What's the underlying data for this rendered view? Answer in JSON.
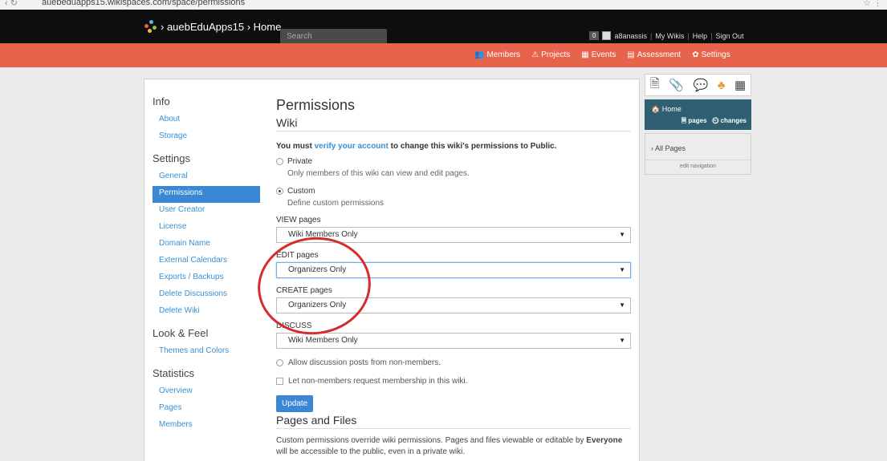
{
  "browser": {
    "url": "auebeduapps15.wikispaces.com/space/permissions",
    "nav": "‹ ↻"
  },
  "topbar": {
    "brand": "› auebEduApps15 › Home",
    "search_placeholder": "Search",
    "notification_count": "0",
    "username": "a8anassis",
    "links": [
      "My Wikis",
      "Help",
      "Sign Out"
    ]
  },
  "mainnav": {
    "items": [
      {
        "icon": "members-icon",
        "label": "Members"
      },
      {
        "icon": "projects-icon",
        "label": "Projects"
      },
      {
        "icon": "events-icon",
        "label": "Events"
      },
      {
        "icon": "assessment-icon",
        "label": "Assessment"
      },
      {
        "icon": "settings-icon",
        "label": "Settings"
      }
    ]
  },
  "sidebar": {
    "info": {
      "heading": "Info",
      "items": [
        "About",
        "Storage"
      ]
    },
    "settings": {
      "heading": "Settings",
      "items": [
        "General",
        "Permissions",
        "User Creator",
        "License",
        "Domain Name",
        "External Calendars",
        "Exports / Backups",
        "Delete Discussions",
        "Delete Wiki"
      ]
    },
    "look": {
      "heading": "Look & Feel",
      "items": [
        "Themes and Colors"
      ]
    },
    "stats": {
      "heading": "Statistics",
      "items": [
        "Overview",
        "Pages",
        "Members"
      ]
    },
    "active": "Permissions"
  },
  "main": {
    "title": "Permissions",
    "section": "Wiki",
    "verify_prefix": "You must ",
    "verify_link": "verify your account",
    "verify_suffix": " to change this wiki's permissions to Public.",
    "private_label": "Private",
    "private_desc": "Only members of this wiki can view and edit pages.",
    "custom_label": "Custom",
    "custom_desc": "Define custom permissions",
    "selected_mode": "Custom",
    "view_label": "VIEW pages",
    "view_value": "Wiki Members Only",
    "edit_label": "EDIT pages",
    "edit_value": "Organizers Only",
    "create_label": "CREATE pages",
    "create_value": "Organizers Only",
    "discuss_label": "DISCUSS",
    "discuss_value": "Wiki Members Only",
    "allow_discussion": "Allow discussion posts from non-members.",
    "let_request": "Let non-members request membership in this wiki.",
    "update_button": "Update",
    "files_heading": "Pages and Files",
    "files_note_prefix": "Custom permissions override wiki permissions. Pages and files viewable or editable by ",
    "files_note_bold": "Everyone",
    "files_note_suffix": " will be accessible to the public, even in a private wiki."
  },
  "rightpanel": {
    "tool_icons": [
      "page-icon",
      "attach-icon",
      "comment-icon",
      "tree-icon",
      "calendar-icon"
    ],
    "home_title": "Home",
    "pages_link": "pages",
    "changes_link": "changes",
    "all_pages": "All Pages",
    "edit_navigation": "edit navigation"
  },
  "colors": {
    "orange": "#e6644b",
    "blue": "#3a87d5",
    "dark_teal": "#2f5f73",
    "annotation_red": "#d42b2b"
  }
}
